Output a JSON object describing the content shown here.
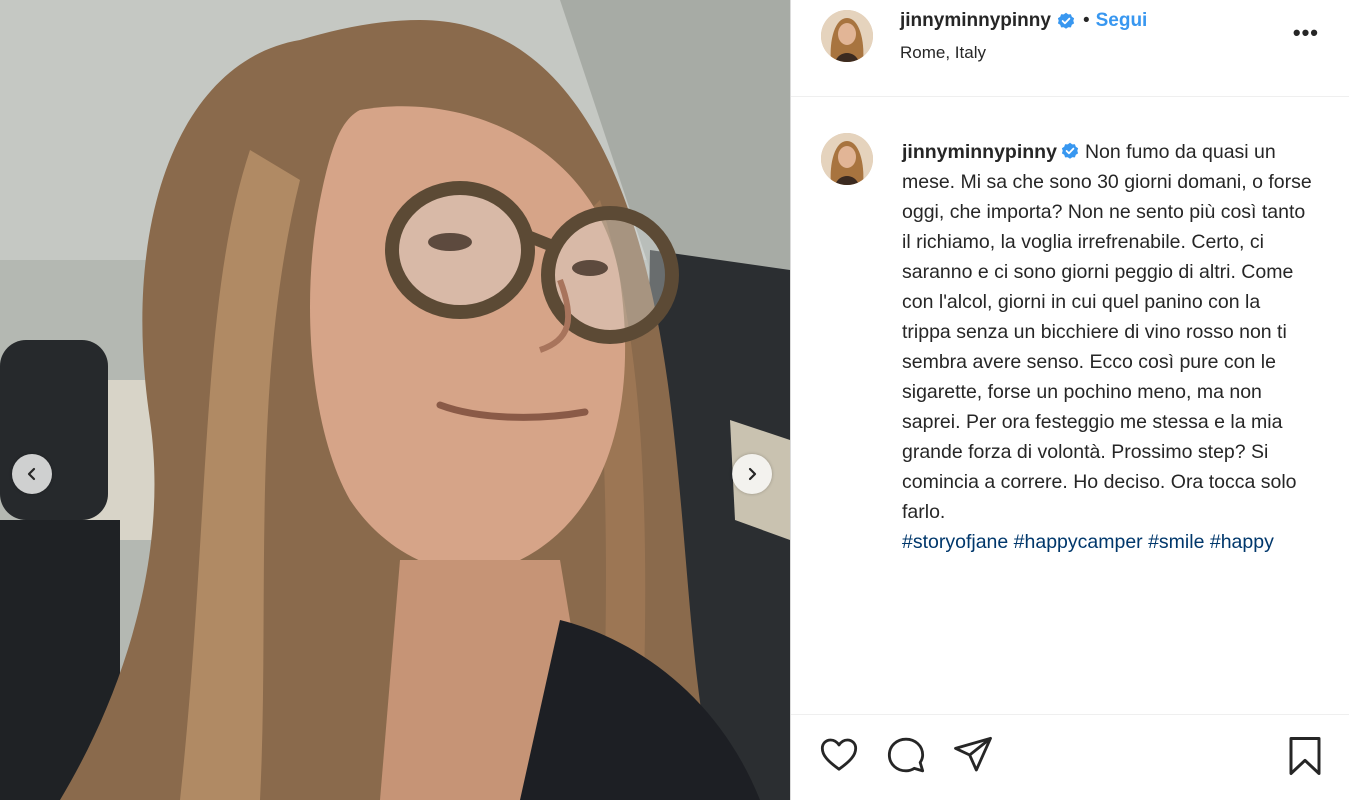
{
  "post": {
    "username": "jinnyminnypinny",
    "dot": "•",
    "follow_label": "Segui",
    "location": "Rome, Italy",
    "more_label": "•••"
  },
  "caption": {
    "username": "jinnyminnypinny",
    "text": "Non fumo da quasi un mese. Mi sa che sono 30 giorni domani, o forse oggi, che importa? Non ne sento più così tanto il richiamo, la voglia irrefrenabile. Certo, ci saranno e ci sono giorni peggio di altri. Come con l'alcol, giorni in cui quel panino con la trippa senza un bicchiere di vino rosso non ti sembra avere senso. Ecco così pure con le sigarette, forse un pochino meno, ma non saprei. Per ora festeggio me stessa e la mia grande forza di volontà. Prossimo step? Si comincia a correre. Ho deciso. Ora tocca solo farlo.",
    "hashtags": [
      "#storyofjane",
      "#happycamper",
      "#smile",
      "#happy"
    ]
  },
  "icons": {
    "verified": "verified-badge-icon",
    "like": "heart-icon",
    "comment": "comment-icon",
    "share": "paper-plane-icon",
    "save": "bookmark-icon",
    "prev": "chevron-left-icon",
    "next": "chevron-right-icon"
  },
  "colors": {
    "accent": "#3897f0",
    "hashtag": "#00376b",
    "text": "#262626"
  }
}
